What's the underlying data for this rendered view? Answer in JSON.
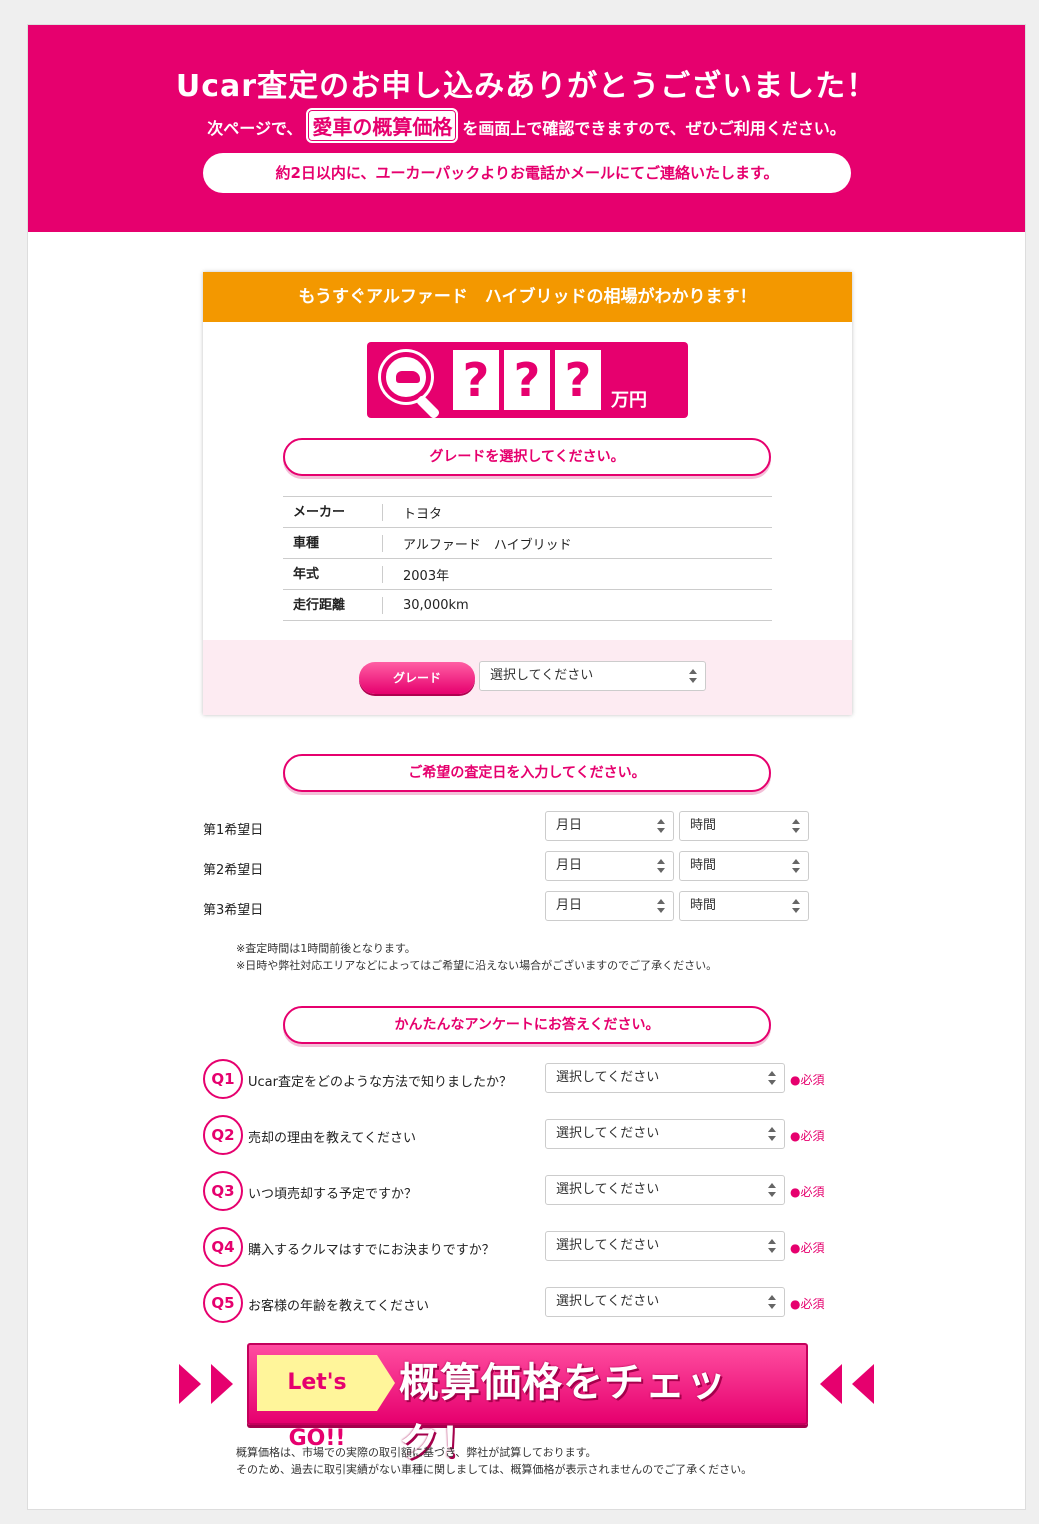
{
  "hero": {
    "title": "Ucar査定のお申し込みありがとうございました！",
    "sub_prefix": "次ページで、",
    "sub_emphasis": "愛車の概算価格",
    "sub_suffix": "を画面上で確認できますので、ぜひご利用ください。",
    "notice": "約2日以内に、ユーカーパックよりお電話かメールにてご連絡いたします。"
  },
  "card": {
    "header": "もうすぐアルファード　ハイブリッドの相場がわかります！",
    "price_placeholder": [
      "?",
      "?",
      "?"
    ],
    "price_unit": "万円",
    "grade_prompt": "グレードを選択してください。",
    "specs": [
      {
        "key": "メーカー",
        "value": "トヨタ"
      },
      {
        "key": "車種",
        "value": "アルファード　ハイブリッド"
      },
      {
        "key": "年式",
        "value": "2003年"
      },
      {
        "key": "走行距離",
        "value": "30,000km"
      }
    ],
    "grade_button": "グレード",
    "grade_select": "選択してください"
  },
  "dates": {
    "prompt": "ご希望の査定日を入力してください。",
    "rows": [
      {
        "label": "第1希望日",
        "day": "月日",
        "time": "時間"
      },
      {
        "label": "第2希望日",
        "day": "月日",
        "time": "時間"
      },
      {
        "label": "第3希望日",
        "day": "月日",
        "time": "時間"
      }
    ],
    "notes": [
      "※査定時間は1時間前後となります。",
      "※日時や弊社対応エリアなどによってはご希望に沿えない場合がございますのでご了承ください。"
    ]
  },
  "survey": {
    "prompt": "かんたんなアンケートにお答えください。",
    "questions": [
      {
        "num": "Q1",
        "text": "Ucar査定をどのような方法で知りましたか？",
        "select": "選択してください",
        "required": "●必須"
      },
      {
        "num": "Q2",
        "text": "売却の理由を教えてください",
        "select": "選択してください",
        "required": "●必須"
      },
      {
        "num": "Q3",
        "text": "いつ頃売却する予定ですか？",
        "select": "選択してください",
        "required": "●必須"
      },
      {
        "num": "Q4",
        "text": "購入するクルマはすでにお決まりですか？",
        "select": "選択してください",
        "required": "●必須"
      },
      {
        "num": "Q5",
        "text": "お客様の年齢を教えてください",
        "select": "選択してください",
        "required": "●必須"
      }
    ]
  },
  "cta": {
    "badge": "Let's GO!!",
    "label": "概算価格をチェック！"
  },
  "footer": {
    "lines": [
      "概算価格は、市場での実際の取引額に基づき、弊社が試算しております。",
      "そのため、過去に取引実績がない車種に関しましては、概算価格が表示されませんのでご了承ください。"
    ]
  },
  "colors": {
    "accent": "#e6006e",
    "orange": "#f39800",
    "soft_pink": "#fdebf2",
    "cta_badge": "#fff59a"
  }
}
